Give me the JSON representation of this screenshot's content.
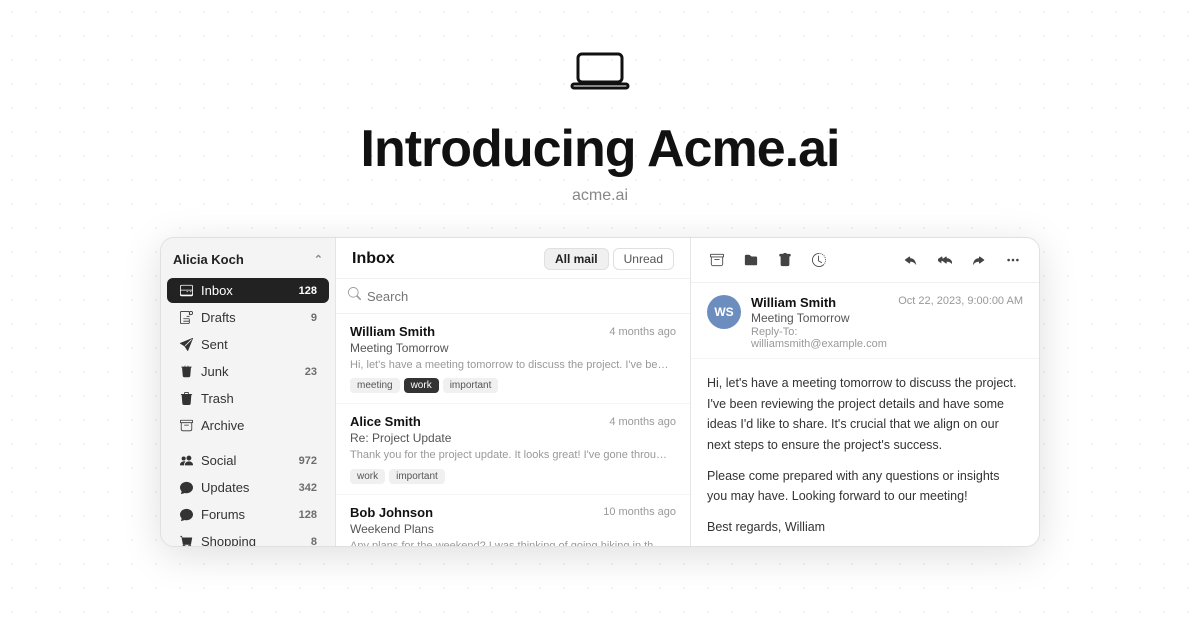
{
  "hero": {
    "icon_label": "laptop-icon",
    "title": "Introducing Acme.ai",
    "subtitle": "acme.ai"
  },
  "sidebar": {
    "user_name": "Alicia Koch",
    "items": [
      {
        "id": "inbox",
        "label": "Inbox",
        "badge": "128",
        "active": true,
        "icon": "inbox-icon"
      },
      {
        "id": "drafts",
        "label": "Drafts",
        "badge": "9",
        "active": false,
        "icon": "drafts-icon"
      },
      {
        "id": "sent",
        "label": "Sent",
        "badge": "",
        "active": false,
        "icon": "sent-icon"
      },
      {
        "id": "junk",
        "label": "Junk",
        "badge": "23",
        "active": false,
        "icon": "junk-icon"
      },
      {
        "id": "trash",
        "label": "Trash",
        "badge": "",
        "active": false,
        "icon": "trash-icon"
      },
      {
        "id": "archive",
        "label": "Archive",
        "badge": "",
        "active": false,
        "icon": "archive-icon"
      }
    ],
    "categories": [
      {
        "id": "social",
        "label": "Social",
        "badge": "972",
        "icon": "social-icon"
      },
      {
        "id": "updates",
        "label": "Updates",
        "badge": "342",
        "icon": "updates-icon"
      },
      {
        "id": "forums",
        "label": "Forums",
        "badge": "128",
        "icon": "forums-icon"
      },
      {
        "id": "shopping",
        "label": "Shopping",
        "badge": "8",
        "icon": "shopping-icon"
      }
    ]
  },
  "email_list": {
    "title": "Inbox",
    "filter_all": "All mail",
    "filter_unread": "Unread",
    "search_placeholder": "Search",
    "emails": [
      {
        "id": "email-1",
        "sender": "William Smith",
        "subject": "Meeting Tomorrow",
        "preview": "Hi, let's have a meeting tomorrow to discuss the project. I've been reviewing the project details and have some ideas I'd like to share. It's crucial that we align on our next step...",
        "time": "4 months ago",
        "tags": [
          "meeting",
          "work",
          "important"
        ],
        "tag_styles": [
          "normal",
          "dark",
          "normal"
        ]
      },
      {
        "id": "email-2",
        "sender": "Alice Smith",
        "subject": "Re: Project Update",
        "preview": "Thank you for the project update. It looks great! I've gone through the report, and the progress is impressive. The team has done a fantastic job, and I appreciate the hard...",
        "time": "4 months ago",
        "tags": [
          "work",
          "important"
        ],
        "tag_styles": [
          "normal",
          "normal"
        ]
      },
      {
        "id": "email-3",
        "sender": "Bob Johnson",
        "subject": "Weekend Plans",
        "preview": "Any plans for the weekend? I was thinking of going hiking in the nearby mountains. It's",
        "time": "10 months ago",
        "tags": [],
        "tag_styles": []
      }
    ]
  },
  "email_detail": {
    "sender_name": "William Smith",
    "sender_initials": "WS",
    "subject": "Meeting Tomorrow",
    "reply_to": "Reply-To: williamsmith@example.com",
    "timestamp": "Oct 22, 2023, 9:00:00 AM",
    "body_paragraphs": [
      "Hi, let's have a meeting tomorrow to discuss the project. I've been reviewing the project details and have some ideas I'd like to share. It's crucial that we align on our next steps to ensure the project's success.",
      "Please come prepared with any questions or insights you may have. Looking forward to our meeting!",
      "Best regards, William"
    ],
    "toolbar_buttons": [
      {
        "id": "archive-btn",
        "icon": "📁",
        "label": "archive-button"
      },
      {
        "id": "move-btn",
        "icon": "📂",
        "label": "move-button"
      },
      {
        "id": "delete-btn",
        "icon": "🗑",
        "label": "delete-button"
      },
      {
        "id": "snooze-btn",
        "icon": "🕐",
        "label": "snooze-button"
      },
      {
        "id": "reply-btn",
        "icon": "↩",
        "label": "reply-button"
      },
      {
        "id": "reply-all-btn",
        "icon": "↩",
        "label": "reply-all-button"
      },
      {
        "id": "forward-btn",
        "icon": "↪",
        "label": "forward-button"
      },
      {
        "id": "more-btn",
        "icon": "⋯",
        "label": "more-button"
      }
    ]
  }
}
